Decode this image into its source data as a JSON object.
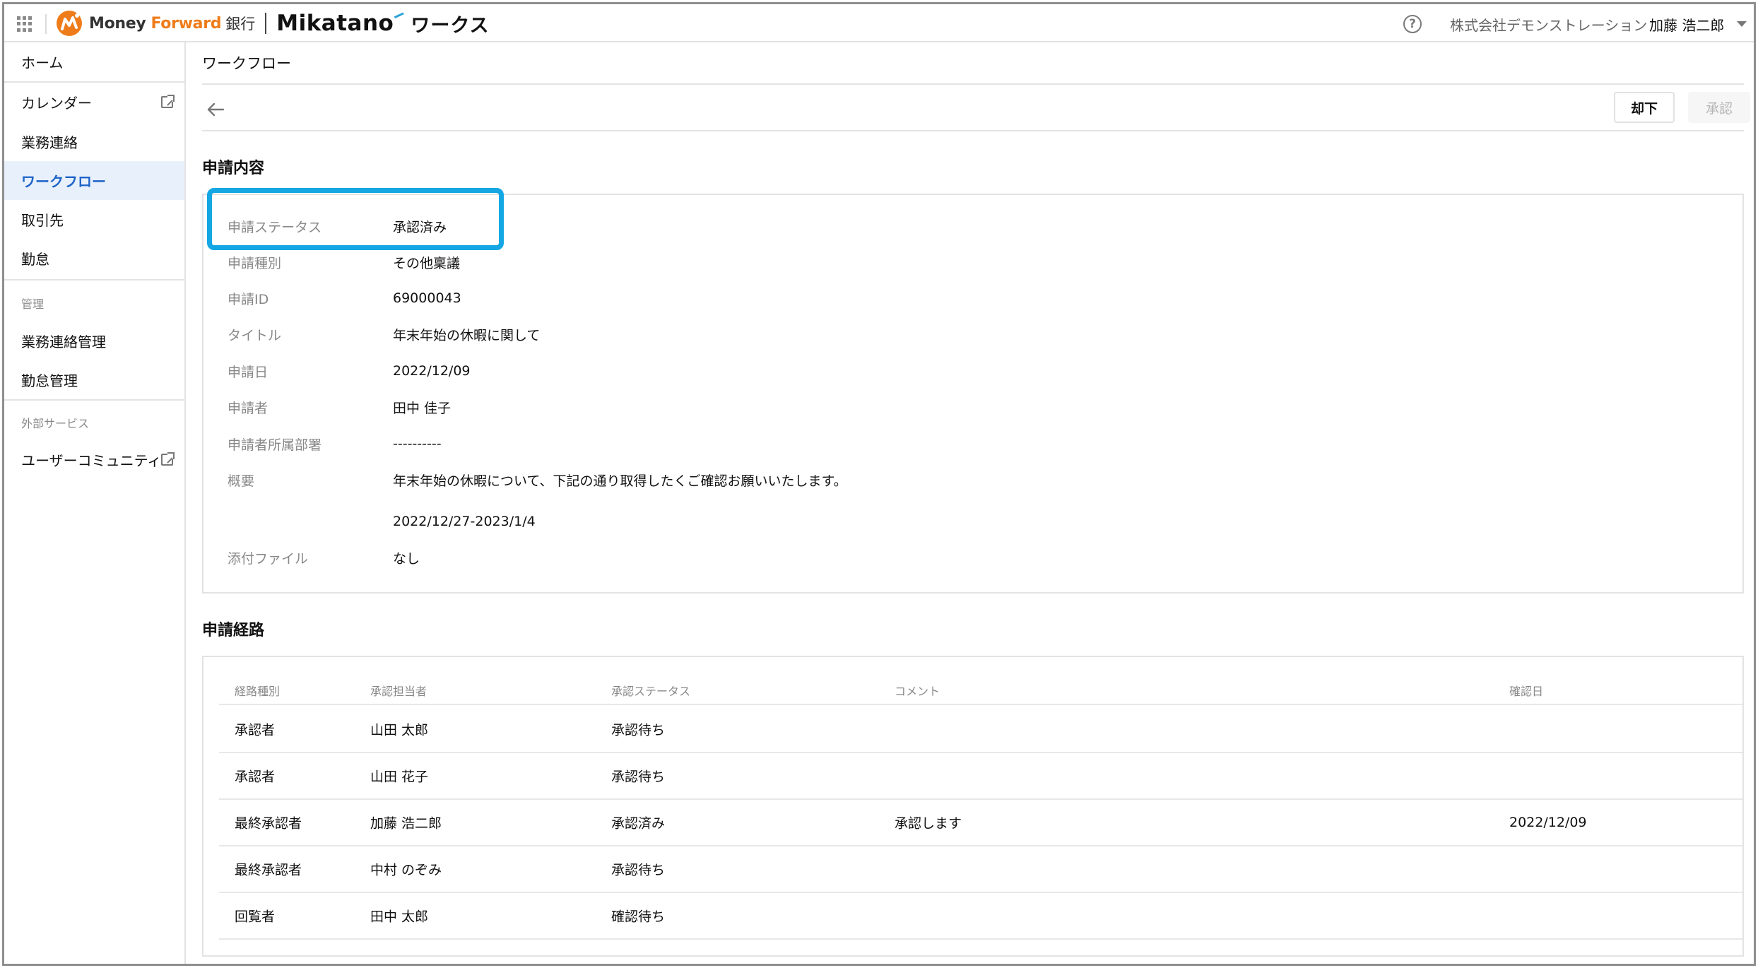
{
  "header": {
    "apps_icon": "grid-icon",
    "brand": {
      "money": "Money",
      "forward": "Forward",
      "ginko": "銀行",
      "mikatano": "Mikatano",
      "works": "ワークス"
    },
    "help_icon": "?",
    "company": "株式会社デモンストレーション",
    "user": "加藤 浩二郎",
    "colors": {
      "brand_orange": "#ef7c1a",
      "accent_blue": "#1e63c8",
      "highlight": "#14a7e3"
    }
  },
  "sidebar": {
    "items": [
      {
        "label": "ホーム"
      },
      {
        "label": "カレンダー",
        "external": true
      },
      {
        "label": "業務連絡"
      },
      {
        "label": "ワークフロー",
        "active": true
      },
      {
        "label": "取引先"
      },
      {
        "label": "勤怠"
      }
    ],
    "admin_group": "管理",
    "admin_items": [
      {
        "label": "業務連絡管理"
      },
      {
        "label": "勤怠管理"
      }
    ],
    "external_group": "外部サービス",
    "external_items": [
      {
        "label": "ユーザーコミュニティ",
        "external": true
      }
    ]
  },
  "main": {
    "page_title": "ワークフロー",
    "reject_label": "却下",
    "approve_label": "承認",
    "detail_title": "申請内容",
    "details": [
      {
        "label": "申請ステータス",
        "value": "承認済み"
      },
      {
        "label": "申請種別",
        "value": "その他稟議"
      },
      {
        "label": "申請ID",
        "value": "69000043"
      },
      {
        "label": "タイトル",
        "value": "年末年始の休暇に関して"
      },
      {
        "label": "申請日",
        "value": "2022/12/09"
      },
      {
        "label": "申請者",
        "value": "田中 佳子"
      },
      {
        "label": "申請者所属部署",
        "value": "----------"
      },
      {
        "label": "概要",
        "value": "年末年始の休暇について、下記の通り取得したくご確認お願いいたします。"
      },
      {
        "label": "",
        "value": "2022/12/27-2023/1/4"
      },
      {
        "label": "添付ファイル",
        "value": "なし"
      }
    ],
    "route_title": "申請経路",
    "route_headers": [
      "経路種別",
      "承認担当者",
      "承認ステータス",
      "コメント",
      "確認日"
    ],
    "route_rows": [
      [
        "承認者",
        "山田 太郎",
        "承認待ち",
        "",
        ""
      ],
      [
        "承認者",
        "山田 花子",
        "承認待ち",
        "",
        ""
      ],
      [
        "最終承認者",
        "加藤 浩二郎",
        "承認済み",
        "承認します",
        "2022/12/09"
      ],
      [
        "最終承認者",
        "中村 のぞみ",
        "承認待ち",
        "",
        ""
      ],
      [
        "回覧者",
        "田中 太郎",
        "確認待ち",
        "",
        ""
      ]
    ]
  }
}
